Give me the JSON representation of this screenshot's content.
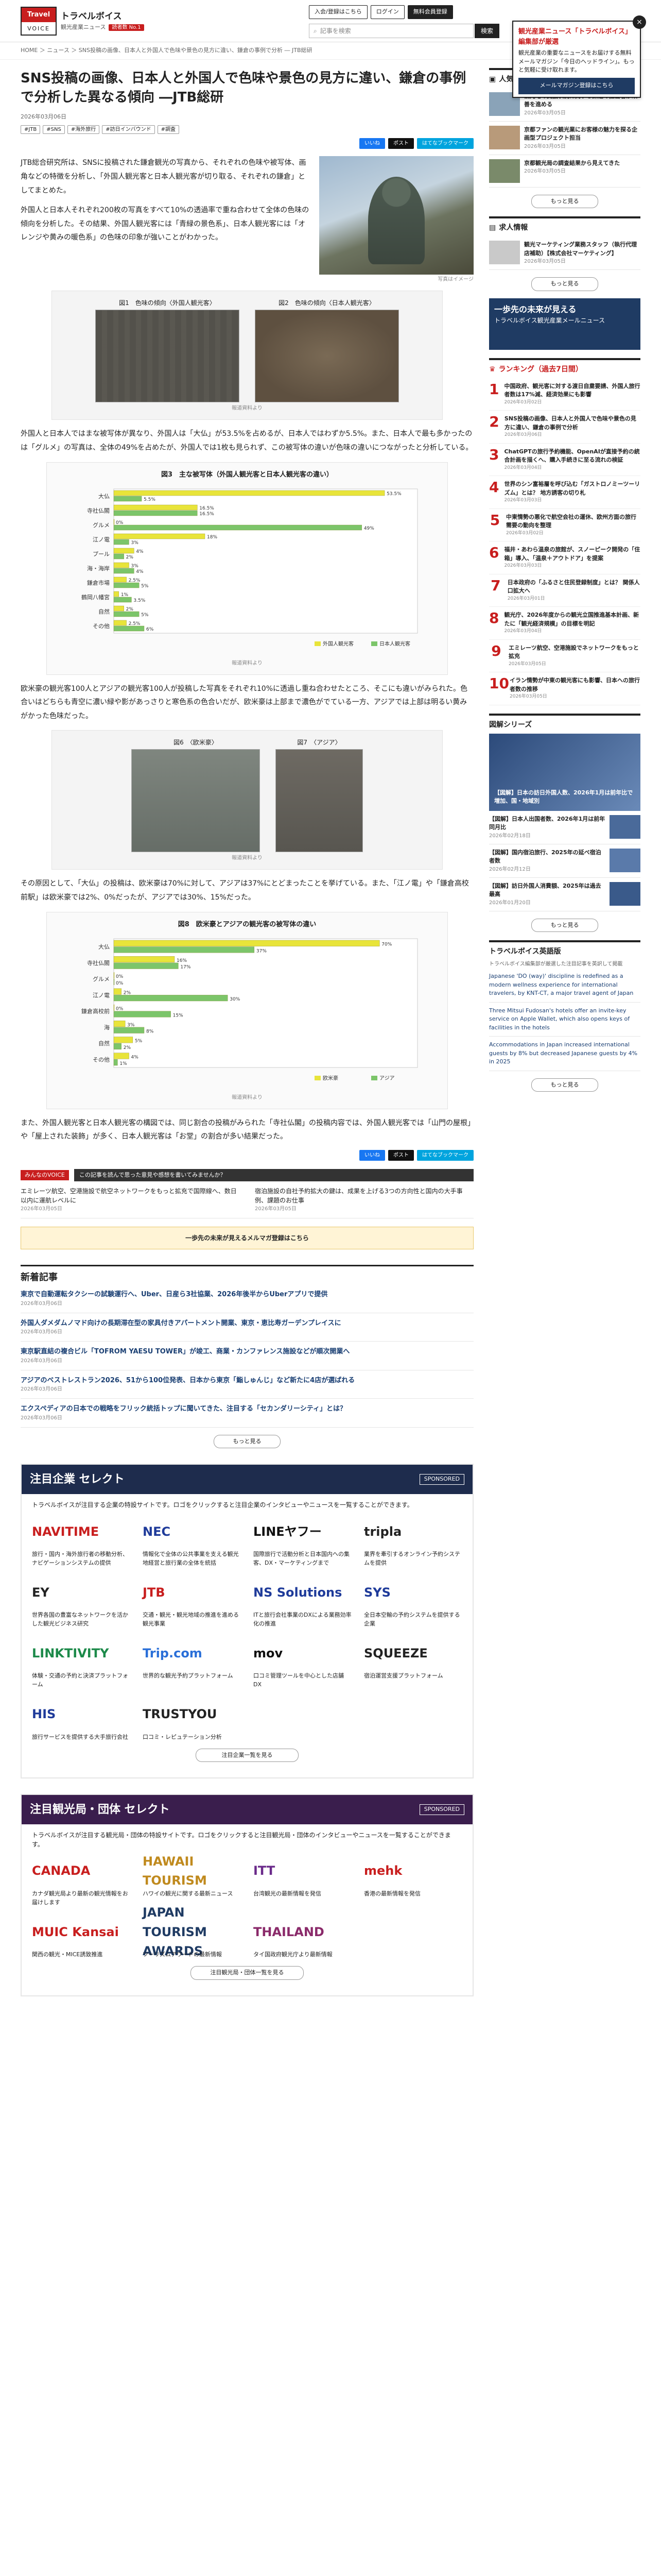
{
  "header": {
    "logo_top": "Travel",
    "logo_bottom": "VOICE",
    "site_name": "トラベルボイス",
    "site_sub": "観光産業ニュース",
    "badge": "読者数 No.1",
    "btn_member": "入会/登録はこちら",
    "btn_login": "ログイン",
    "btn_new": "無料会員登録",
    "search_placeholder": "記事を検索",
    "search_btn": "検索"
  },
  "popup": {
    "title": "観光産業ニュース「トラベルボイス」編集部が厳選",
    "body": "観光産業の重要なニュースをお届けする無料メールマガジン「今日のヘッドライン」。もっと気軽に受け取れます。",
    "banner": "メールマガジン登録はこちら",
    "close": "×"
  },
  "breadcrumb": "HOME ＞ ニュース ＞ SNS投稿の画像、日本人と外国人で色味や景色の見方に違い、鎌倉の事例で分析 ― JTB総研",
  "article": {
    "title": "SNS投稿の画像、日本人と外国人で色味や景色の見方に違い、鎌倉の事例で分析した異なる傾向 ―JTB総研",
    "date": "2026年03月06日",
    "tags": [
      "#JTB",
      "#SNS",
      "#海外旅行",
      "#訪日インバウンド",
      "#調査"
    ],
    "share": [
      "いいね",
      "ポスト",
      "はてなブックマーク"
    ],
    "lead": "JTB総合研究所は、SNSに投稿された鎌倉観光の写真から、それぞれの色味や被写体、画角などの特徴を分析し、「外国人観光客と日本人観光客が切り取る、それぞれの鎌倉」としてまとめた。",
    "lead2": "外国人と日本人それぞれ200枚の写真をすべて10%の透過率で重ね合わせて全体の色味の傾向を分析した。その結果、外国人観光客には「青緑の景色系」、日本人観光客には「オレンジや黄みの暖色系」の色味の印象が強いことがわかった。",
    "photo_cap": "写真はイメージ",
    "fig1_label": "図1　色味の傾向〈外国人観光客〉",
    "fig2_label": "図2　色味の傾向〈日本人観光客〉",
    "fig_src": "報道資料より",
    "p1": "外国人と日本人ではまな被写体が異なり、外国人は「大仏」が53.5%を占めるが、日本人ではわずか5.5%。また、日本人で最も多かったのは「グルメ」の写真は、全体の49%を占めたが、外国人では1枚も見られず、この被写体の違いが色味の違いにつながったと分析している。",
    "fig3_title": "図3　主な被写体（外国人観光客と日本人観光客の違い）",
    "p2": "欧米豪の観光客100人とアジアの観光客100人が投稿した写真をそれぞれ10%に透過し重ね合わせたところ、そこにも違いがみられた。色合いはどちらも青空に濃い緑や影があっさりと寒色系の色合いだが、欧米豪は上部まで濃色がでている一方、アジアでは上部は明るい黄みがかった色味だった。",
    "fig6_label": "図6　〈欧米豪〉",
    "fig7_label": "図7　〈アジア〉",
    "p3": "その原因として、「大仏」の投稿は、欧米豪は70%に対して、アジアは37%にとどまったことを挙げている。また、「江ノ電」や「鎌倉高校前駅」は欧米豪では2%、0%だったが、アジアでは30%、15%だった。",
    "fig8_title": "図8　欧米豪とアジアの観光客の被写体の違い",
    "p4": "また、外国人観光客と日本人観光客の構図では、同じ割合の投稿がみられた「寺社仏閣」の投稿内容では、外国人観光客では「山門の屋根」や「屋上された装飾」が多く、日本人観光客は「お堂」の割合が多い結果だった。"
  },
  "chart_data": [
    {
      "type": "bar",
      "title": "図3　主な被写体（外国人観光客と日本人観光客の違い）",
      "categories": [
        "大仏",
        "寺社仏閣",
        "グルメ",
        "江ノ電",
        "プール",
        "海・海岸",
        "鎌倉市場",
        "鶴岡八幡宮",
        "自然",
        "その他"
      ],
      "series": [
        {
          "name": "外国人観光客",
          "values": [
            53.5,
            16.5,
            0,
            18,
            4,
            3,
            2.5,
            1,
            2,
            2.5
          ]
        },
        {
          "name": "日本人観光客",
          "values": [
            5.5,
            16.5,
            49,
            3,
            2,
            4,
            5,
            3.5,
            5,
            6
          ]
        }
      ],
      "xlim": [
        0,
        60
      ]
    },
    {
      "type": "bar",
      "title": "図8　欧米豪とアジアの観光客の被写体の違い",
      "categories": [
        "大仏",
        "寺社仏閣",
        "グルメ",
        "江ノ電",
        "鎌倉高校前",
        "海",
        "自然",
        "その他"
      ],
      "series": [
        {
          "name": "欧米豪",
          "values": [
            70,
            16,
            0,
            2,
            0,
            3,
            5,
            4
          ]
        },
        {
          "name": "アジア",
          "values": [
            37,
            17,
            0,
            30,
            15,
            8,
            2,
            1
          ]
        }
      ],
      "xlim": [
        0,
        80
      ]
    }
  ],
  "voice": {
    "tag": "みんなのVOICE",
    "bar": "この記事を読んで思った意見や感想を書いてみませんか？",
    "items": [
      {
        "t": "エミレーツ航空、空港施設で航空ネットワークをもっと拡充で国際線へ、数日以内に運航レベルに",
        "d": "2026年03月05日"
      },
      {
        "t": "宿泊施設の自社予約拡大の鍵は、成果を上げる3つの方向性と国内の大手事例、課題のお仕事",
        "d": "2026年03月05日"
      }
    ],
    "cta": "一歩先の未来が見えるメルマガ登録はこちら"
  },
  "latest": {
    "title": "新着記事",
    "items": [
      {
        "t": "東京で自動運転タクシーの試験運行へ、Uber、日産ら3社協業、2026年後半からUberアプリで提供",
        "d": "2026年03月06日"
      },
      {
        "t": "外国人ダメダムノマド向けの長期滞在型の家具付きアパートメント開業、東京・恵比寿ガーデンプレイスに",
        "d": "2026年03月06日"
      },
      {
        "t": "東京駅直結の複合ビル「TOFROM YAESU TOWER」が竣工、商業・カンファレンス施設などが順次開業へ",
        "d": "2026年03月06日"
      },
      {
        "t": "アジアのベストレストラン2026、51から100位発表、日本から東京「鮨しゅんじ」など新たに4店が選ばれる",
        "d": "2026年03月06日"
      },
      {
        "t": "エクスペディアの日本での戦略をフリック統括トップに聞いてきた、注目する「セカンダリーシティ」とは？",
        "d": "2026年03月06日"
      }
    ],
    "more": "もっと見る"
  },
  "sponsor1": {
    "title": "注目企業 セレクト",
    "tag": "SPONSORED",
    "desc": "トラベルボイスが注目する企業の特設サイトです。ロゴをクリックすると注目企業のインタビューやニュースを一覧することができます。",
    "items": [
      {
        "logo": "NAVITIME",
        "color": "#c81e1e",
        "text": "旅行・国内・海外旅行者の移動分析、ナビゲーションシステムの提供"
      },
      {
        "logo": "NEC",
        "color": "#1f3b9a",
        "text": "情報化で全体の公共事業を支える観光地経営と旅行業の全体を統括"
      },
      {
        "logo": "LINEヤフー",
        "color": "#111",
        "text": "国際旅行で活動分析と日本国内への集客、DX・マーケティングまで"
      },
      {
        "logo": "tripla",
        "color": "#222",
        "text": "業界を牽引するオンライン予約システムを提供"
      },
      {
        "logo": "EY",
        "color": "#222",
        "text": "世界各国の豊富なネットワークを活かした観光ビジネス研究"
      },
      {
        "logo": "JTB",
        "color": "#c81e1e",
        "text": "交通・観光・観光地域の推進を進める観光事業"
      },
      {
        "logo": "NS Solutions",
        "color": "#1f3b9a",
        "text": "ITと旅行会社事業のDXによる業務効率化の推進"
      },
      {
        "logo": "SYS",
        "color": "#1f3b9a",
        "text": "全日本空輸の予約システムを提供する企業"
      },
      {
        "logo": "LINKTIVITY",
        "color": "#1d8a4a",
        "text": "体験・交通の予約と決済プラットフォーム"
      },
      {
        "logo": "Trip.com",
        "color": "#2a6fd8",
        "text": "世界的な観光予約プラットフォーム"
      },
      {
        "logo": "mov",
        "color": "#111",
        "text": "口コミ管理ツールを中心とした店舗DX"
      },
      {
        "logo": "SQUEEZE",
        "color": "#222",
        "text": "宿泊運営支援プラットフォーム"
      },
      {
        "logo": "HIS",
        "color": "#1f3b9a",
        "text": "旅行サービスを提供する大手旅行会社"
      },
      {
        "logo": "TRUSTYOU",
        "color": "#222",
        "text": "口コミ・レピュテーション分析"
      }
    ],
    "more": "注目企業一覧を見る"
  },
  "sponsor2": {
    "title": "注目観光局・団体 セレクト",
    "tag": "SPONSORED",
    "desc": "トラベルボイスが注目する観光局・団体の特設サイトです。ロゴをクリックすると注目観光局・団体のインタビューやニュースを一覧することができます。",
    "items": [
      {
        "logo": "CANADA",
        "color": "#c81e1e",
        "text": "カナダ観光局より最新の観光情報をお届けします"
      },
      {
        "logo": "HAWAII TOURISM",
        "color": "#c08a1e",
        "text": "ハワイの観光に関する最新ニュース"
      },
      {
        "logo": "ITT",
        "color": "#6a2a8a",
        "text": "台湾観光の最新情報を発信"
      },
      {
        "logo": "mehk",
        "color": "#c81e1e",
        "text": "香港の最新情報を発信"
      },
      {
        "logo": "MUIC Kansai",
        "color": "#c81e1e",
        "text": "関西の観光・MICE誘致推進"
      },
      {
        "logo": "JAPAN TOURISM AWARDS",
        "color": "#1f3b63",
        "text": "ツーリズムアワードの最新情報"
      },
      {
        "logo": "THAILAND",
        "color": "#8a2a6a",
        "text": "タイ国政府観光庁より最新情報"
      }
    ],
    "more": "注目観光局・団体一覧を見る"
  },
  "sidebar": {
    "pickup_title": "人気職種セレクト",
    "pickup": [
      {
        "t": "観光地の支援状況に関する課題の担当者が改善を進める",
        "d": "2026年03月05日"
      },
      {
        "t": "京都ファンの観光業にお客様の魅力を探る企画型プロジェクト担当",
        "d": "2026年03月05日"
      },
      {
        "t": "京都観光局の調査結果から見えてきた",
        "d": "2026年03月05日"
      }
    ],
    "jobs_title": "求人情報",
    "jobs": [
      {
        "t": "観光マーケティング業務スタッフ（執行代理店補助）【株式会社マーケティング】",
        "d": "2026年03月05日"
      }
    ],
    "banner_title": "一歩先の未来が見える",
    "banner_sub": "トラベルボイス観光産業メールニュース",
    "rank_title": "ランキング（過去7日間）",
    "ranking": [
      {
        "t": "中国政府、観光客に対する渡日自粛要請、外国人旅行者数は17%減、経済効果にも影響",
        "d": "2026年03月02日"
      },
      {
        "t": "SNS投稿の画像、日本人と外国人で色味や景色の見方に違い、鎌倉の事例で分析",
        "d": "2026年03月06日"
      },
      {
        "t": "ChatGPTの旅行予約機能、OpenAIが直接予約の統合計画を描くへ、購入手続きに至る流れの検証",
        "d": "2026年03月04日"
      },
      {
        "t": "世界のシン富裕層を呼び込む「ガストロノミーツーリズム」とは？ 地方誘客の切り札",
        "d": "2026年03月03日"
      },
      {
        "t": "中東情勢の悪化で航空会社の運休、欧州方面の旅行需要の動向を整理",
        "d": "2026年03月02日"
      },
      {
        "t": "福井・あわら温泉の旅館が、スノーピーク開発の「住箱」導入、「温泉＋アウトドア」を提案",
        "d": "2026年03月03日"
      },
      {
        "t": "日本政府の「ふるさと住民登録制度」とは？ 関係人口拡大へ",
        "d": "2026年03月01日"
      },
      {
        "t": "観光庁、2026年度からの観光立国推進基本計画、新たに「観光経済規模」の目標を明記",
        "d": "2026年03月04日"
      },
      {
        "t": "エミレーツ航空、空港施設でネットワークをもっと拡充",
        "d": "2026年03月05日"
      },
      {
        "t": "イラン情勢が中東の観光客にも影響、日本への旅行者数の推移",
        "d": "2026年03月05日"
      }
    ],
    "series_title": "図解シリーズ",
    "series": [
      {
        "t": "【図解】日本の訪日外国人数、2026年1月は前年比で増加、国・地域別",
        "d": "2026年02月18日"
      },
      {
        "t": "【図解】日本人出国者数、2026年1月は前年同月比",
        "d": "2026年02月18日"
      },
      {
        "t": "【図解】国内宿泊旅行、2025年の延べ宿泊者数",
        "d": "2026年02月12日"
      },
      {
        "t": "【図解】訪日外国人消費額、2025年は過去最高",
        "d": "2026年01月20日"
      }
    ],
    "series_more": "もっと見る",
    "english_title": "トラベルボイス英語版",
    "english_desc": "トラベルボイス編集部が厳選した注目記事を英訳して掲載",
    "english": [
      {
        "t": "Japanese 'DO (way)' discipline is redefined as a modern wellness experience for international travelers, by KNT-CT, a major travel agent of Japan"
      },
      {
        "t": "Three Mitsui Fudosan's hotels offer an invite-key service on Apple Wallet, which also opens keys of facilities in the hotels"
      },
      {
        "t": "Accommodations in Japan increased international guests by 8% but decreased Japanese guests by 4% in 2025"
      }
    ],
    "english_more": "もっと見る"
  }
}
